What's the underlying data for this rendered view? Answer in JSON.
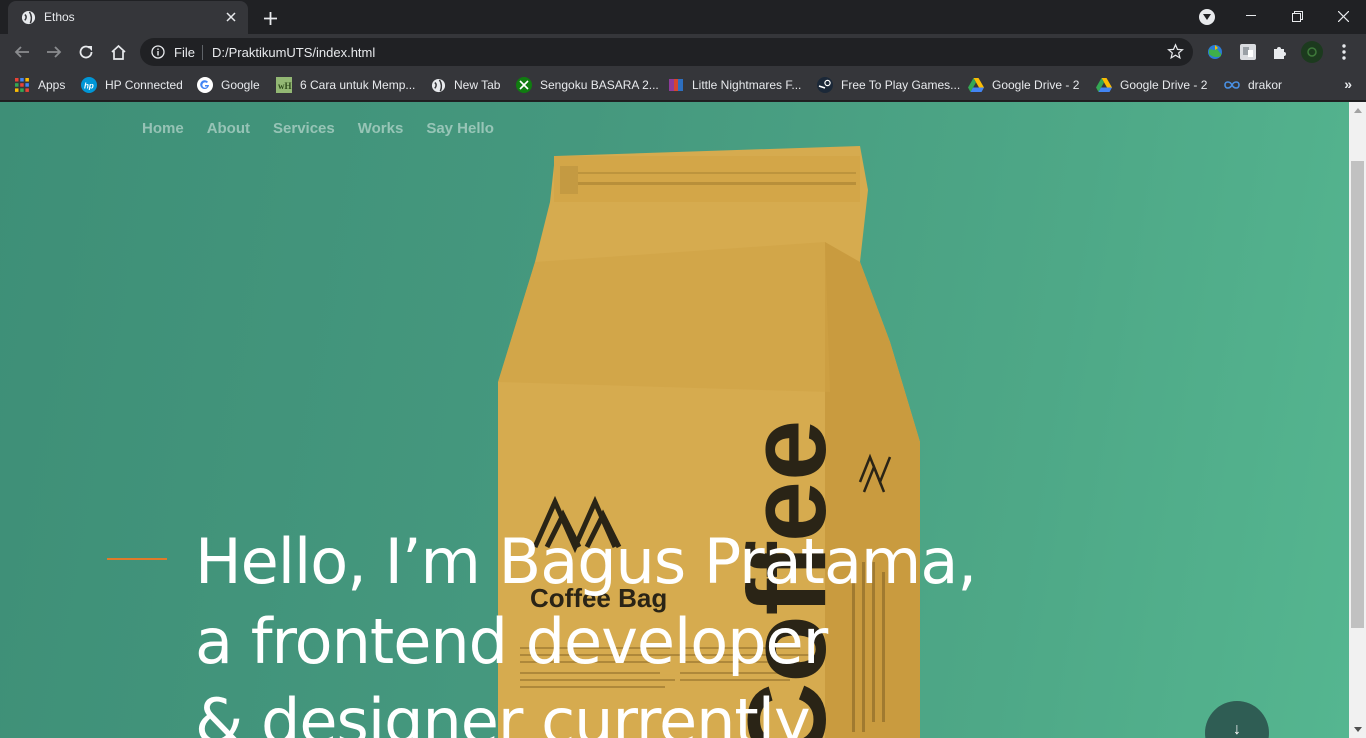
{
  "browser": {
    "tab_title": "Ethos",
    "omnibox_scheme_label": "File",
    "url": "D:/PraktikumUTS/index.html"
  },
  "bookmarks": [
    {
      "label": "Apps",
      "icon": "apps-grid-icon"
    },
    {
      "label": "HP Connected",
      "icon": "hp-icon"
    },
    {
      "label": "Google",
      "icon": "google-icon"
    },
    {
      "label": "6 Cara untuk Memp...",
      "icon": "wikihow-icon"
    },
    {
      "label": "New Tab",
      "icon": "globe-icon"
    },
    {
      "label": "Sengoku BASARA 2...",
      "icon": "xbox-icon"
    },
    {
      "label": "Little Nightmares F...",
      "icon": "winrar-icon"
    },
    {
      "label": "Free To Play Games...",
      "icon": "steam-icon"
    },
    {
      "label": "Google Drive - 2",
      "icon": "google-drive-icon"
    },
    {
      "label": "Google Drive - 2",
      "icon": "google-drive-icon"
    },
    {
      "label": "drakor",
      "icon": "infinity-icon"
    }
  ],
  "site": {
    "nav": [
      "Home",
      "About",
      "Services",
      "Works",
      "Say Hello"
    ],
    "hero_lines": [
      "Hello, I’m Bagus Pratama,",
      "a frontend developer",
      "& designer currently"
    ],
    "bag_brand_text": "Coffee Bag",
    "bag_vertical_text": "Coffee",
    "scroll_button_glyph": "↓"
  },
  "colors": {
    "accent_line": "#e07a2a",
    "hero_bg": "#4ea887",
    "bag": "#d4a84b"
  }
}
